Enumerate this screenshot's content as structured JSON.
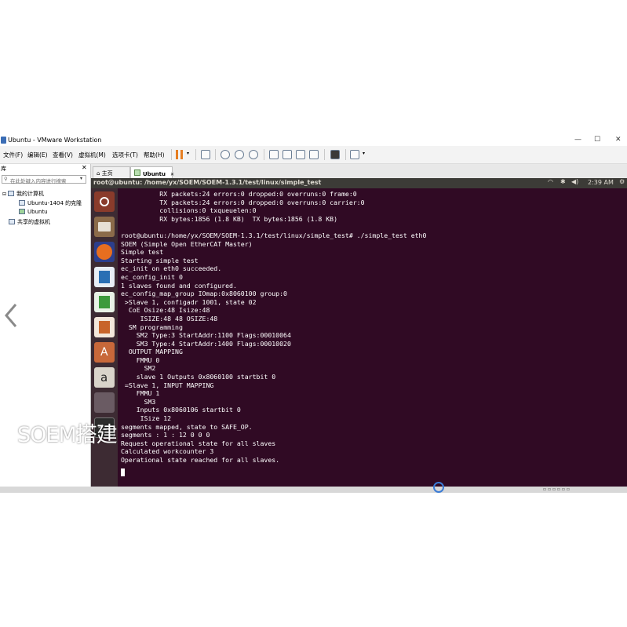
{
  "window": {
    "title": "Ubuntu - VMware Workstation"
  },
  "menu": [
    "文件(F)",
    "编辑(E)",
    "查看(V)",
    "虚拟机(M)",
    "选项卡(T)",
    "帮助(H)"
  ],
  "library": {
    "title": "库",
    "search_placeholder": "在此处键入内容进行搜索",
    "tree": [
      "我的计算机",
      "Ubuntu-1404 的克隆",
      "Ubuntu",
      "共享的虚拟机"
    ]
  },
  "tabs": [
    "主页",
    "Ubuntu"
  ],
  "ubuntu_bar": {
    "window_title": "root@ubuntu: /home/yx/SOEM/SOEM-1.3.1/test/linux/simple_test",
    "clock": "2:39 AM"
  },
  "terminal_lines": [
    "          RX packets:24 errors:0 dropped:0 overruns:0 frame:0",
    "          TX packets:24 errors:0 dropped:0 overruns:0 carrier:0",
    "          collisions:0 txqueuelen:0",
    "          RX bytes:1856 (1.8 KB)  TX bytes:1856 (1.8 KB)",
    "",
    "root@ubuntu:/home/yx/SOEM/SOEM-1.3.1/test/linux/simple_test# ./simple_test eth0",
    "SOEM (Simple Open EtherCAT Master)",
    "Simple test",
    "Starting simple test",
    "ec_init on eth0 succeeded.",
    "ec_config_init 0",
    "1 slaves found and configured.",
    "ec_config_map_group IOmap:0x8060100 group:0",
    " >Slave 1, configadr 1001, state 02",
    "  CoE Osize:48 Isize:48",
    "     ISIZE:48 48 OSIZE:48",
    "  SM programming",
    "    SM2 Type:3 StartAddr:1100 Flags:00010064",
    "    SM3 Type:4 StartAddr:1400 Flags:00010020",
    "  OUTPUT MAPPING",
    "    FMMU 0",
    "      SM2",
    "    slave 1 Outputs 0x8060100 startbit 0",
    " =Slave 1, INPUT MAPPING",
    "    FMMU 1",
    "      SM3",
    "    Inputs 0x8060106 startbit 0",
    "     ISize 12",
    "segments mapped, state to SAFE_OP.",
    "segments : 1 : 12 0 0 0",
    "Request operational state for all slaves",
    "Calculated workcounter 3",
    "Operational state reached for all slaves."
  ],
  "caption": "SOEM搭建",
  "colors": {
    "terminal_bg": "#300a24",
    "launcher_bg": "#3d2b33",
    "top_bar": "#3c3b37",
    "accent_pause": "#e67e22"
  },
  "icons": [
    "ubuntu-dash-icon",
    "files-icon",
    "firefox-icon",
    "writer-icon",
    "calc-icon",
    "impress-icon",
    "software-center-icon",
    "amazon-icon",
    "settings-icon",
    "terminal-icon"
  ]
}
